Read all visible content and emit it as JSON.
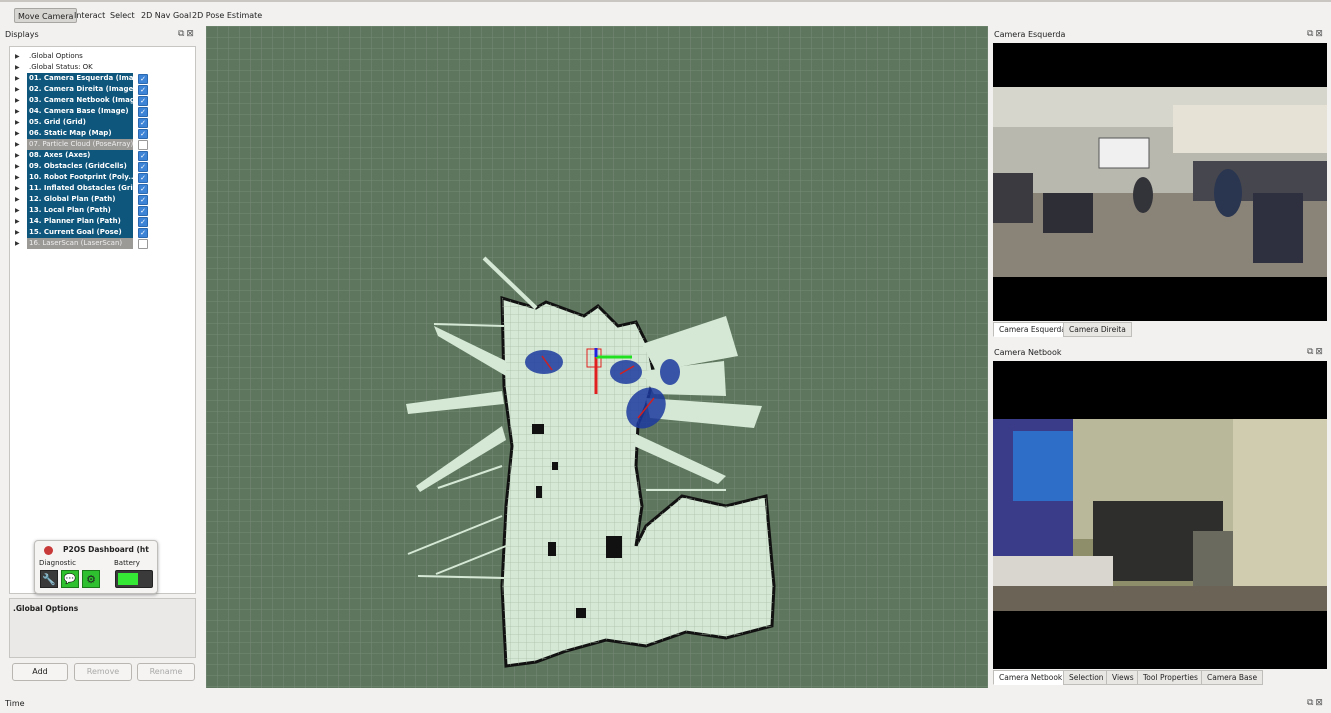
{
  "toolbar": {
    "tools": [
      "Move Camera",
      "Interact",
      "Select",
      "2D Nav Goal",
      "2D Pose Estimate"
    ]
  },
  "displays": {
    "title": "Displays",
    "items": [
      {
        "label": ".Global Options",
        "enabled": null
      },
      {
        "label": ".Global Status: OK",
        "enabled": null
      },
      {
        "label": "01. Camera Esquerda (Ima...",
        "enabled": true
      },
      {
        "label": "02. Camera Direita (Image)",
        "enabled": true
      },
      {
        "label": "03. Camera Netbook (Image)",
        "enabled": true
      },
      {
        "label": "04. Camera Base (Image)",
        "enabled": true
      },
      {
        "label": "05. Grid (Grid)",
        "enabled": true
      },
      {
        "label": "06. Static Map (Map)",
        "enabled": true
      },
      {
        "label": "07. Particle Cloud (PoseArray)",
        "enabled": false
      },
      {
        "label": "08. Axes (Axes)",
        "enabled": true
      },
      {
        "label": "09. Obstacles (GridCells)",
        "enabled": true
      },
      {
        "label": "10. Robot Footprint (Poly...",
        "enabled": true
      },
      {
        "label": "11. Inflated Obstacles (Gri...",
        "enabled": true
      },
      {
        "label": "12. Global Plan (Path)",
        "enabled": true
      },
      {
        "label": "13. Local Plan (Path)",
        "enabled": true
      },
      {
        "label": "14. Planner Plan (Path)",
        "enabled": true
      },
      {
        "label": "15. Current Goal (Pose)",
        "enabled": true
      },
      {
        "label": "16. LaserScan (LaserScan)",
        "enabled": false
      }
    ],
    "properties_title": ".Global Options",
    "add_label": "Add",
    "remove_label": "Remove",
    "rename_label": "Rename"
  },
  "dashboard": {
    "title": "P2OS Dashboard (htt",
    "diagnostic_label": "Diagnostic",
    "battery_label": "Battery",
    "battery_level": 0.6
  },
  "camera_left": {
    "title": "Camera Esquerda",
    "tabs": [
      "Camera Esquerda",
      "Camera Direita"
    ]
  },
  "camera_netbook": {
    "title": "Camera Netbook",
    "tabs": [
      "Camera Netbook",
      "Selection",
      "Views",
      "Tool Properties",
      "Camera Base"
    ]
  },
  "time": {
    "title": "Time"
  },
  "colors": {
    "viewport_bg": "#5e765e",
    "map_free": "#d5e8d5",
    "map_wall": "#111111",
    "selection": "#0f567c",
    "footprint": "#1c3a9e"
  }
}
